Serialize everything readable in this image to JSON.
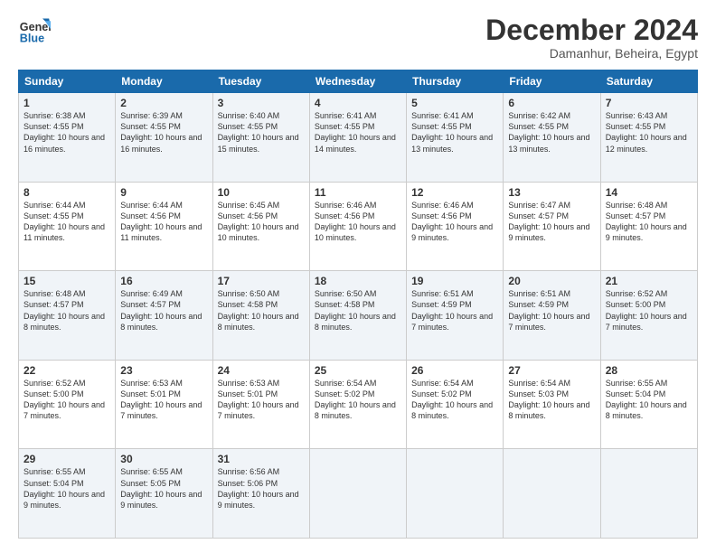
{
  "logo": {
    "line1": "General",
    "line2": "Blue"
  },
  "title": "December 2024",
  "location": "Damanhur, Beheira, Egypt",
  "headers": [
    "Sunday",
    "Monday",
    "Tuesday",
    "Wednesday",
    "Thursday",
    "Friday",
    "Saturday"
  ],
  "weeks": [
    [
      {
        "day": "1",
        "rise": "6:38 AM",
        "set": "4:55 PM",
        "hours": "10 hours and 16 minutes."
      },
      {
        "day": "2",
        "rise": "6:39 AM",
        "set": "4:55 PM",
        "hours": "10 hours and 16 minutes."
      },
      {
        "day": "3",
        "rise": "6:40 AM",
        "set": "4:55 PM",
        "hours": "10 hours and 15 minutes."
      },
      {
        "day": "4",
        "rise": "6:41 AM",
        "set": "4:55 PM",
        "hours": "10 hours and 14 minutes."
      },
      {
        "day": "5",
        "rise": "6:41 AM",
        "set": "4:55 PM",
        "hours": "10 hours and 13 minutes."
      },
      {
        "day": "6",
        "rise": "6:42 AM",
        "set": "4:55 PM",
        "hours": "10 hours and 13 minutes."
      },
      {
        "day": "7",
        "rise": "6:43 AM",
        "set": "4:55 PM",
        "hours": "10 hours and 12 minutes."
      }
    ],
    [
      {
        "day": "8",
        "rise": "6:44 AM",
        "set": "4:55 PM",
        "hours": "10 hours and 11 minutes."
      },
      {
        "day": "9",
        "rise": "6:44 AM",
        "set": "4:56 PM",
        "hours": "10 hours and 11 minutes."
      },
      {
        "day": "10",
        "rise": "6:45 AM",
        "set": "4:56 PM",
        "hours": "10 hours and 10 minutes."
      },
      {
        "day": "11",
        "rise": "6:46 AM",
        "set": "4:56 PM",
        "hours": "10 hours and 10 minutes."
      },
      {
        "day": "12",
        "rise": "6:46 AM",
        "set": "4:56 PM",
        "hours": "10 hours and 9 minutes."
      },
      {
        "day": "13",
        "rise": "6:47 AM",
        "set": "4:57 PM",
        "hours": "10 hours and 9 minutes."
      },
      {
        "day": "14",
        "rise": "6:48 AM",
        "set": "4:57 PM",
        "hours": "10 hours and 9 minutes."
      }
    ],
    [
      {
        "day": "15",
        "rise": "6:48 AM",
        "set": "4:57 PM",
        "hours": "10 hours and 8 minutes."
      },
      {
        "day": "16",
        "rise": "6:49 AM",
        "set": "4:57 PM",
        "hours": "10 hours and 8 minutes."
      },
      {
        "day": "17",
        "rise": "6:50 AM",
        "set": "4:58 PM",
        "hours": "10 hours and 8 minutes."
      },
      {
        "day": "18",
        "rise": "6:50 AM",
        "set": "4:58 PM",
        "hours": "10 hours and 8 minutes."
      },
      {
        "day": "19",
        "rise": "6:51 AM",
        "set": "4:59 PM",
        "hours": "10 hours and 7 minutes."
      },
      {
        "day": "20",
        "rise": "6:51 AM",
        "set": "4:59 PM",
        "hours": "10 hours and 7 minutes."
      },
      {
        "day": "21",
        "rise": "6:52 AM",
        "set": "5:00 PM",
        "hours": "10 hours and 7 minutes."
      }
    ],
    [
      {
        "day": "22",
        "rise": "6:52 AM",
        "set": "5:00 PM",
        "hours": "10 hours and 7 minutes."
      },
      {
        "day": "23",
        "rise": "6:53 AM",
        "set": "5:01 PM",
        "hours": "10 hours and 7 minutes."
      },
      {
        "day": "24",
        "rise": "6:53 AM",
        "set": "5:01 PM",
        "hours": "10 hours and 7 minutes."
      },
      {
        "day": "25",
        "rise": "6:54 AM",
        "set": "5:02 PM",
        "hours": "10 hours and 8 minutes."
      },
      {
        "day": "26",
        "rise": "6:54 AM",
        "set": "5:02 PM",
        "hours": "10 hours and 8 minutes."
      },
      {
        "day": "27",
        "rise": "6:54 AM",
        "set": "5:03 PM",
        "hours": "10 hours and 8 minutes."
      },
      {
        "day": "28",
        "rise": "6:55 AM",
        "set": "5:04 PM",
        "hours": "10 hours and 8 minutes."
      }
    ],
    [
      {
        "day": "29",
        "rise": "6:55 AM",
        "set": "5:04 PM",
        "hours": "10 hours and 9 minutes."
      },
      {
        "day": "30",
        "rise": "6:55 AM",
        "set": "5:05 PM",
        "hours": "10 hours and 9 minutes."
      },
      {
        "day": "31",
        "rise": "6:56 AM",
        "set": "5:06 PM",
        "hours": "10 hours and 9 minutes."
      },
      null,
      null,
      null,
      null
    ]
  ]
}
